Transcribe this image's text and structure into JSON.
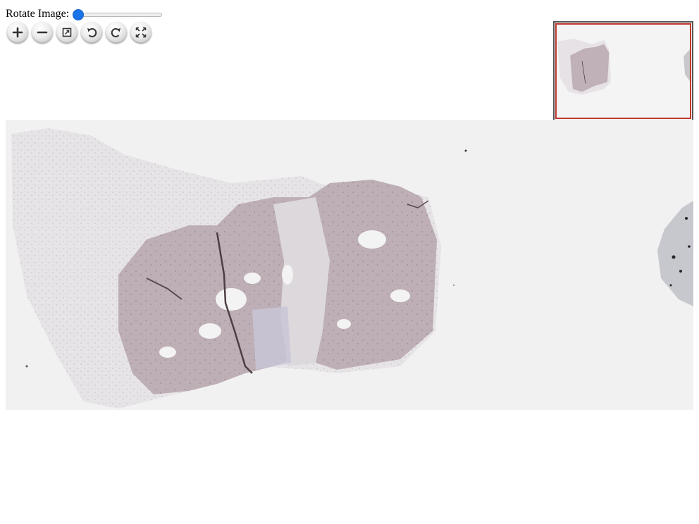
{
  "rotate": {
    "label": "Rotate Image:",
    "value": 0,
    "min": 0,
    "max": 360
  },
  "toolbar": {
    "buttons": [
      {
        "name": "zoom-in-button",
        "icon": "zoom-in-icon"
      },
      {
        "name": "zoom-out-button",
        "icon": "zoom-out-icon"
      },
      {
        "name": "home-button",
        "icon": "home-icon"
      },
      {
        "name": "rotate-left-button",
        "icon": "rotate-left-icon"
      },
      {
        "name": "rotate-right-button",
        "icon": "rotate-right-icon"
      },
      {
        "name": "fullscreen-button",
        "icon": "fullscreen-icon"
      }
    ]
  },
  "colors": {
    "slider_thumb": "#1a73e8",
    "viewer_background": "#f1f1f1",
    "navigator_region": "#c0392b"
  }
}
